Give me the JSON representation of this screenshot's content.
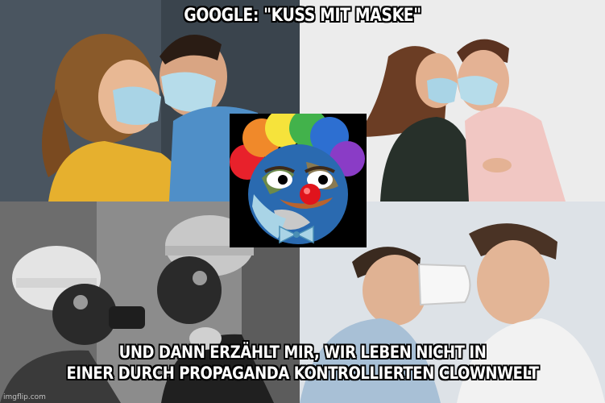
{
  "top_caption": "GOOGLE: \"KUSS MIT MASKE\"",
  "bottom_caption_line1": "UND DANN ERZÄHLT MIR, WIR LEBEN NICHT IN",
  "bottom_caption_line2": "EINER DURCH PROPAGANDA KONTROLLIERTEN CLOWNWELT",
  "watermark": "imgflip.com",
  "colors": {
    "caption_text": "#ffffff",
    "caption_outline": "#000000",
    "clown_nose": "#e0141c",
    "mask_blue": "#a9d4e6"
  },
  "icons": [
    "clown-earth-icon"
  ]
}
